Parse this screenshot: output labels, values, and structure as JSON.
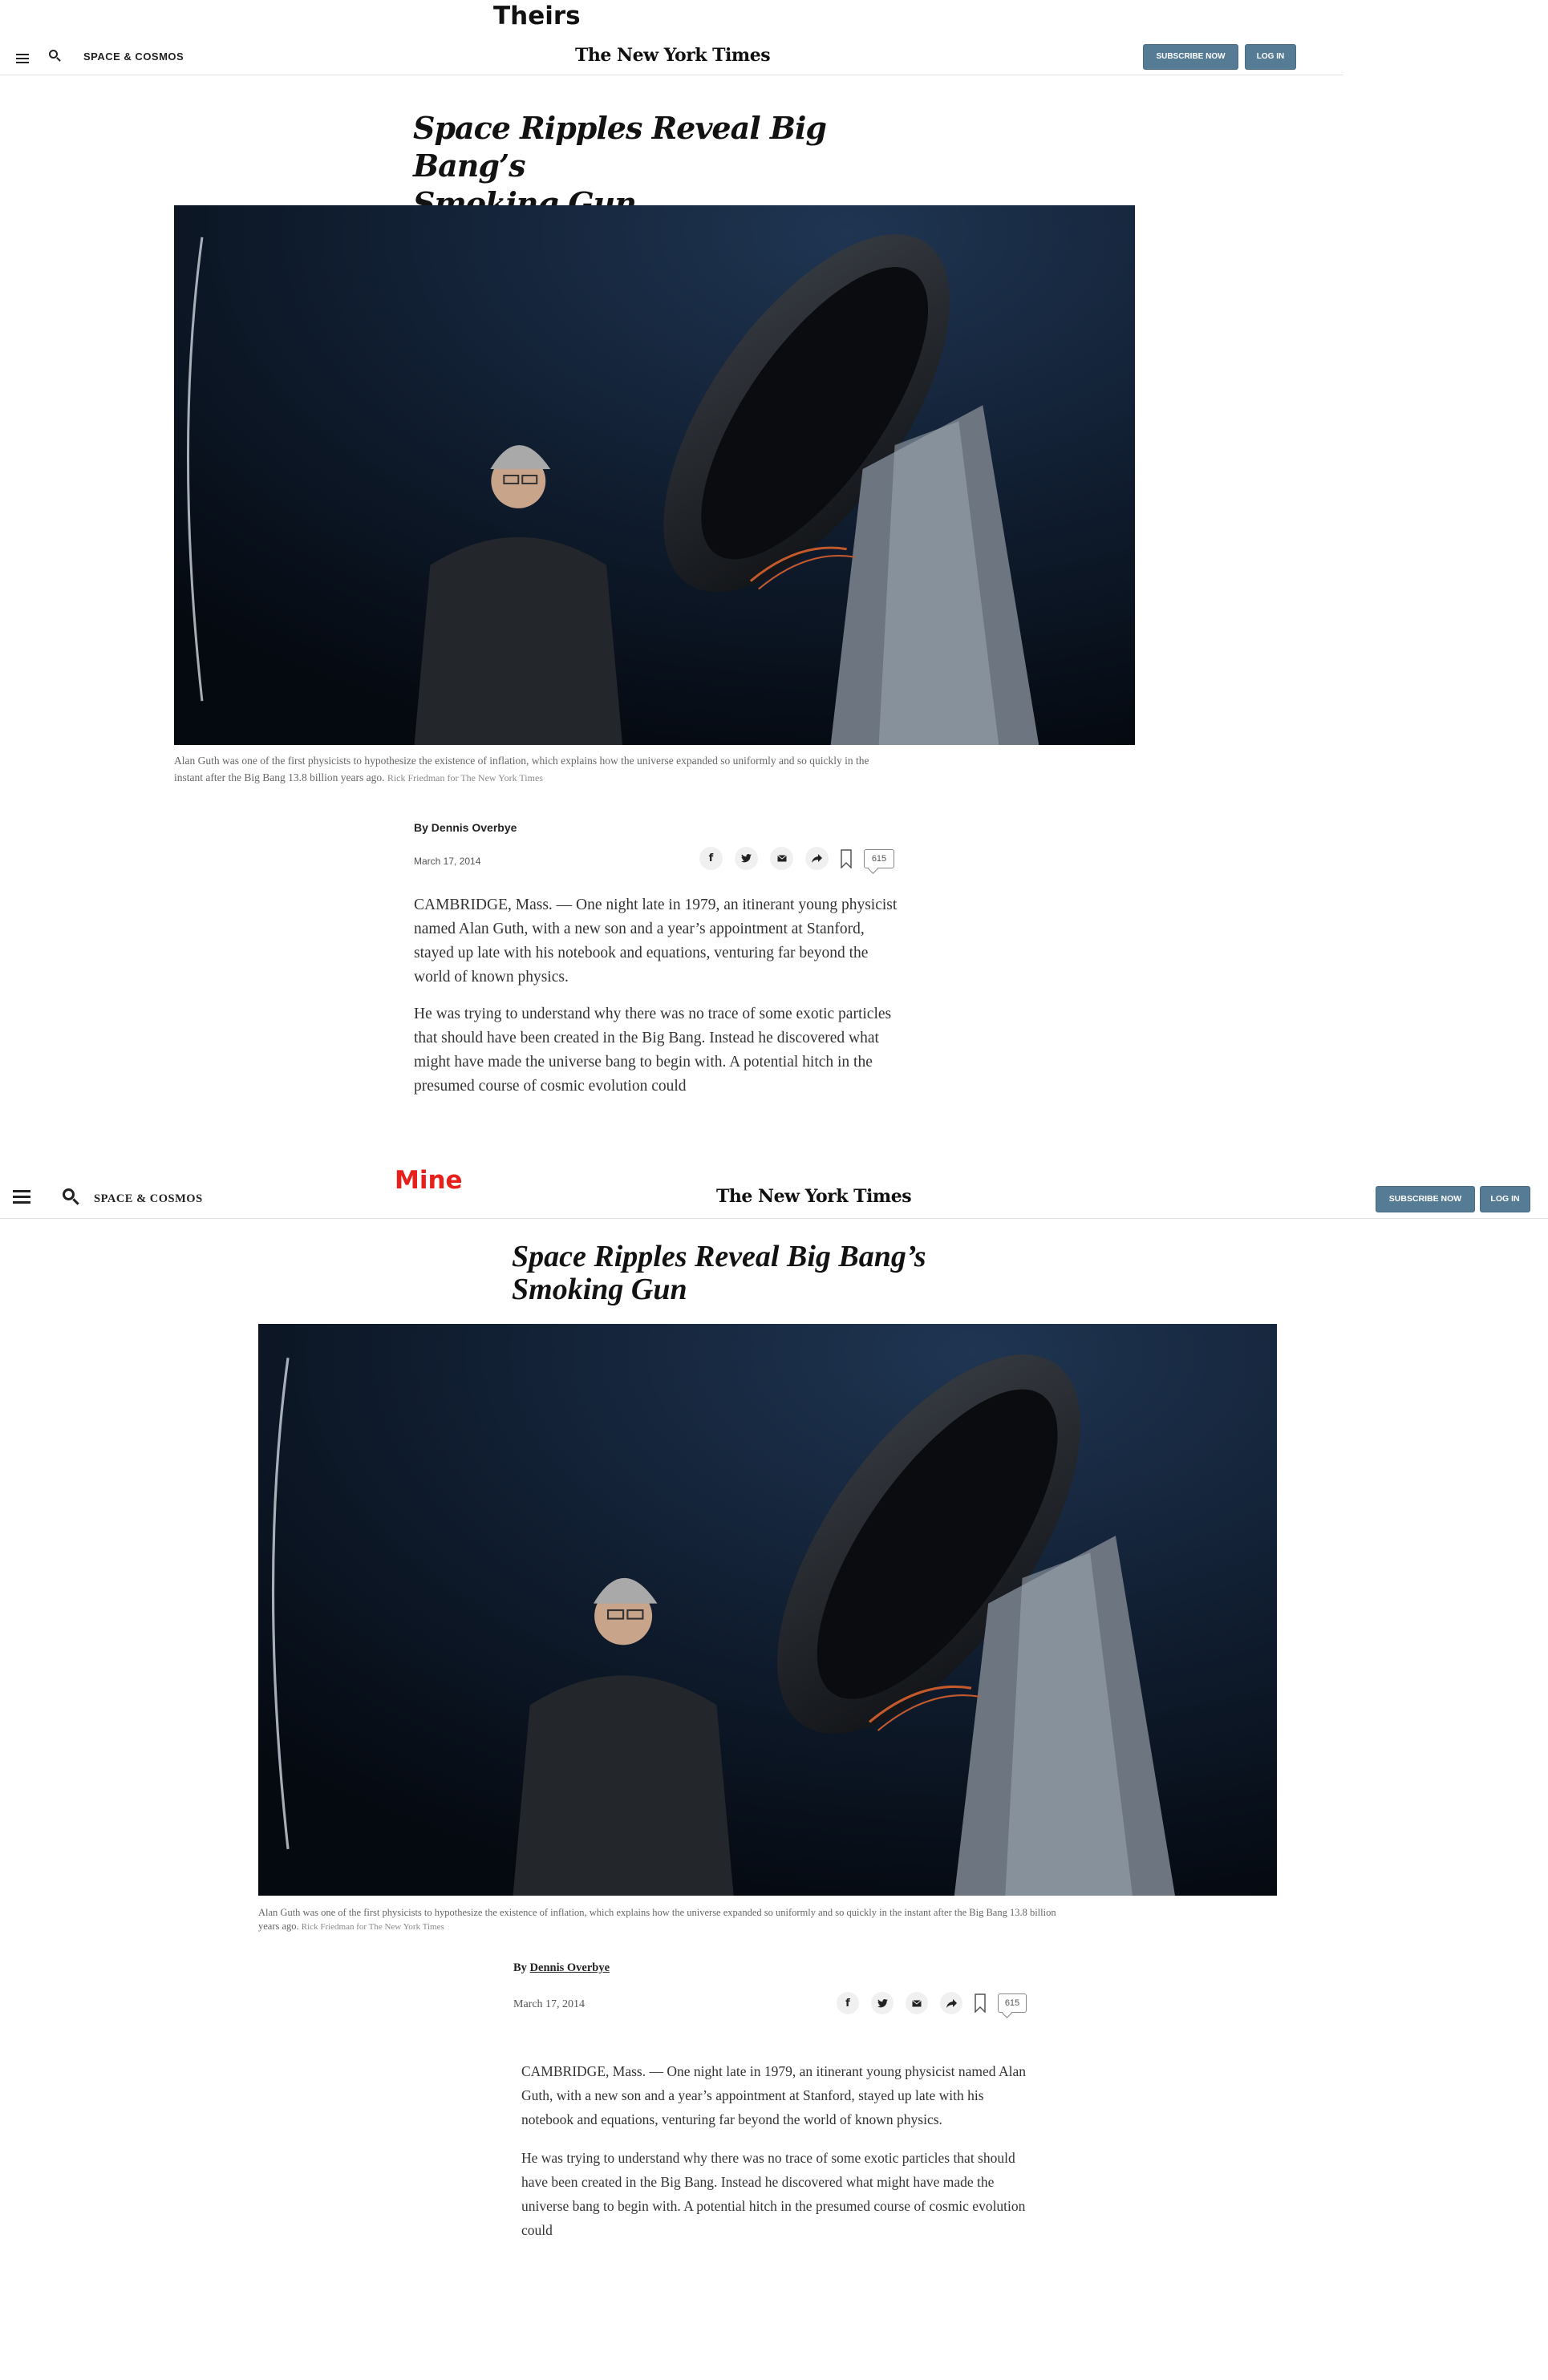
{
  "labels": {
    "theirs": "Theirs",
    "mine": "Mine"
  },
  "colors": {
    "mine_label": "#e8201c",
    "button_bg": "#567b95"
  },
  "header": {
    "section": "SPACE & COSMOS",
    "logo": "The New York Times",
    "subscribe": "SUBSCRIBE NOW",
    "login": "LOG IN"
  },
  "article": {
    "headline_line1": "Space Ripples Reveal Big Bang’s",
    "headline_line2": "Smoking Gun",
    "caption": "Alan Guth was one of the first physicists to hypothesize the existence of inflation, which explains how the universe expanded so uniformly and so quickly in the instant after the Big Bang 13.8 billion years ago.",
    "credit": "Rick Friedman for The New York Times",
    "by_prefix": "By",
    "author": "Dennis Overbye",
    "date": "March 17, 2014",
    "comment_count": "615",
    "paragraphs": [
      "CAMBRIDGE, Mass. — One night late in 1979, an itinerant young physicist named Alan Guth, with a new son and a year’s appointment at Stanford, stayed up late with his notebook and equations, venturing far beyond the world of known physics.",
      "He was trying to understand why there was no trace of some exotic particles that should have been created in the Big Bang. Instead he discovered what might have made the universe bang to begin with. A potential hitch in the presumed course of cosmic evolution could"
    ]
  },
  "share_icons": [
    "facebook-icon",
    "twitter-icon",
    "email-icon",
    "share-icon",
    "bookmark-icon",
    "comments-icon"
  ]
}
